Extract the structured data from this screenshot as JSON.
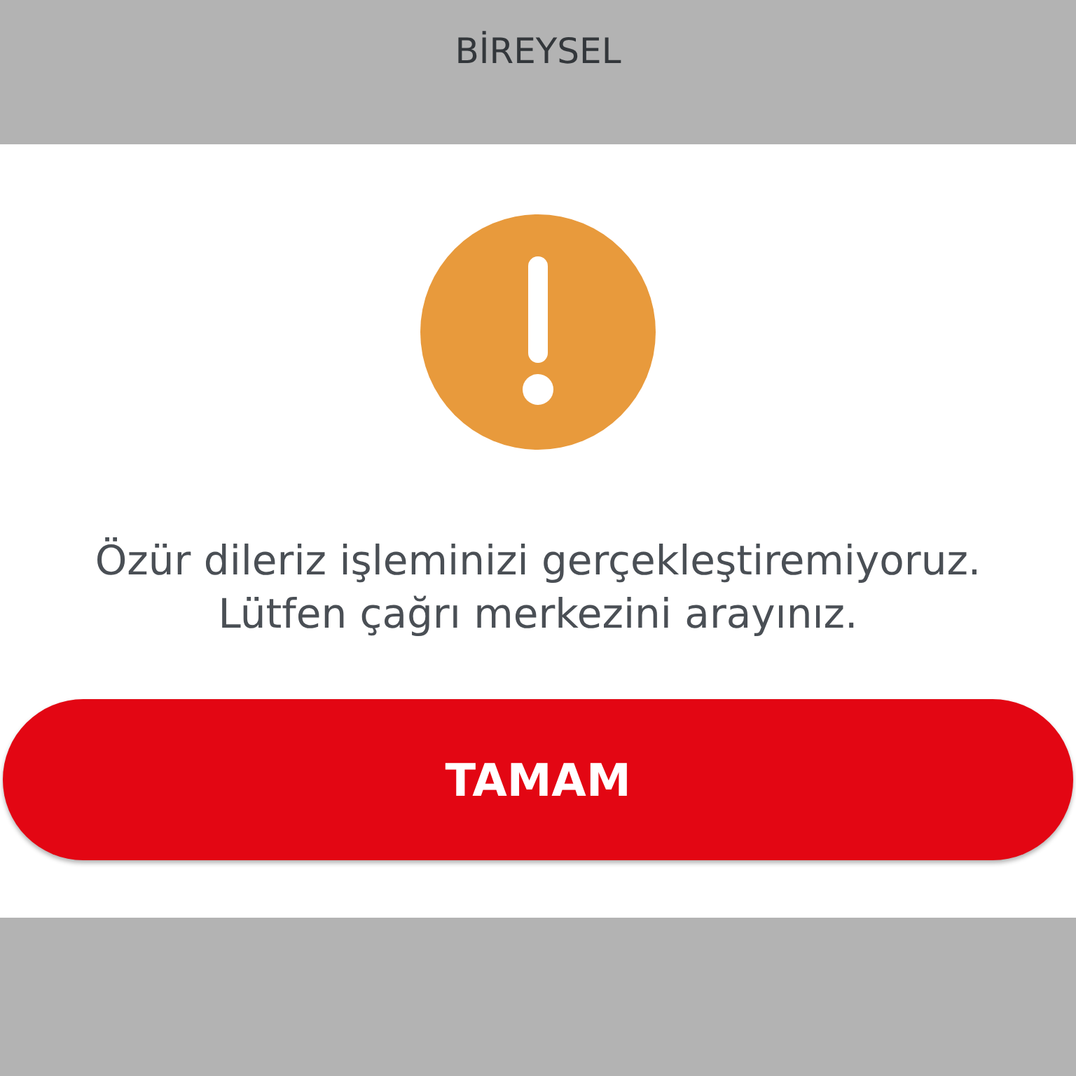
{
  "account": {
    "type": "BİREYSEL"
  },
  "dialog": {
    "kind": "warning",
    "message": [
      "Özür dileriz işleminizi gerçekleştiremiyoruz.",
      "Lütfen çağrı merkezini arayınız."
    ],
    "button": "TAMAM"
  }
}
